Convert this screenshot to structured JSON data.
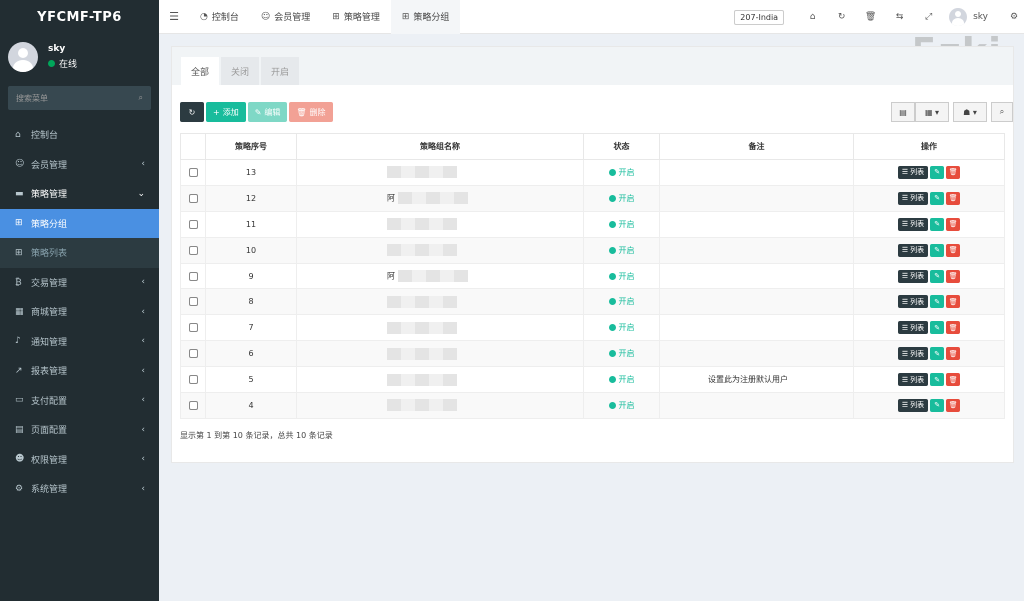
{
  "brand": "YFCMF-TP6",
  "user": {
    "name": "sky",
    "status": "在线"
  },
  "sidebar": {
    "search_placeholder": "搜索菜单",
    "items": [
      {
        "icon": "⌂",
        "label": "控制台",
        "arrow": ""
      },
      {
        "icon": "☺",
        "label": "会员管理",
        "arrow": "‹"
      },
      {
        "icon": "▬",
        "label": "策略管理",
        "arrow": "⌄"
      },
      {
        "icon": "⊞",
        "label": "策略分组",
        "arrow": ""
      },
      {
        "icon": "⊞",
        "label": "策略列表",
        "arrow": ""
      },
      {
        "icon": "₿",
        "label": "交易管理",
        "arrow": "‹"
      },
      {
        "icon": "▦",
        "label": "商城管理",
        "arrow": "‹"
      },
      {
        "icon": "♪",
        "label": "通知管理",
        "arrow": "‹"
      },
      {
        "icon": "↗",
        "label": "报表管理",
        "arrow": "‹"
      },
      {
        "icon": "▭",
        "label": "支付配置",
        "arrow": "‹"
      },
      {
        "icon": "▤",
        "label": "页面配置",
        "arrow": "‹"
      },
      {
        "icon": "☻",
        "label": "权限管理",
        "arrow": "‹"
      },
      {
        "icon": "⚙",
        "label": "系统管理",
        "arrow": "‹"
      }
    ]
  },
  "header": {
    "tabs": [
      {
        "icon": "◔",
        "label": "控制台"
      },
      {
        "icon": "☺",
        "label": "会员管理"
      },
      {
        "icon": "⊞",
        "label": "策略管理"
      },
      {
        "icon": "⊞",
        "label": "策略分组"
      }
    ],
    "region": "207-India",
    "user": "sky"
  },
  "panel": {
    "tabs": [
      "全部",
      "关闭",
      "开启"
    ],
    "buttons": {
      "add": "添加",
      "edit": "编辑",
      "delete": "删除"
    },
    "columns": [
      "策略序号",
      "策略组名称",
      "状态",
      "备注",
      "操作"
    ],
    "rows": [
      {
        "id": "13",
        "name": "",
        "status": "开启",
        "remark": ""
      },
      {
        "id": "12",
        "name": "阿",
        "status": "开启",
        "remark": ""
      },
      {
        "id": "11",
        "name": "",
        "status": "开启",
        "remark": ""
      },
      {
        "id": "10",
        "name": "",
        "status": "开启",
        "remark": ""
      },
      {
        "id": "9",
        "name": "阿",
        "status": "开启",
        "remark": ""
      },
      {
        "id": "8",
        "name": "",
        "status": "开启",
        "remark": ""
      },
      {
        "id": "7",
        "name": "",
        "status": "开启",
        "remark": ""
      },
      {
        "id": "6",
        "name": "",
        "status": "开启",
        "remark": ""
      },
      {
        "id": "5",
        "name": "",
        "status": "开启",
        "remark": "设置此为注册默认用户"
      },
      {
        "id": "4",
        "name": "",
        "status": "开启",
        "remark": ""
      }
    ],
    "op_list_label": "列表",
    "pager": "显示第 1 到第 10 条记录，总共 10 条记录"
  },
  "watermark": "5zki"
}
